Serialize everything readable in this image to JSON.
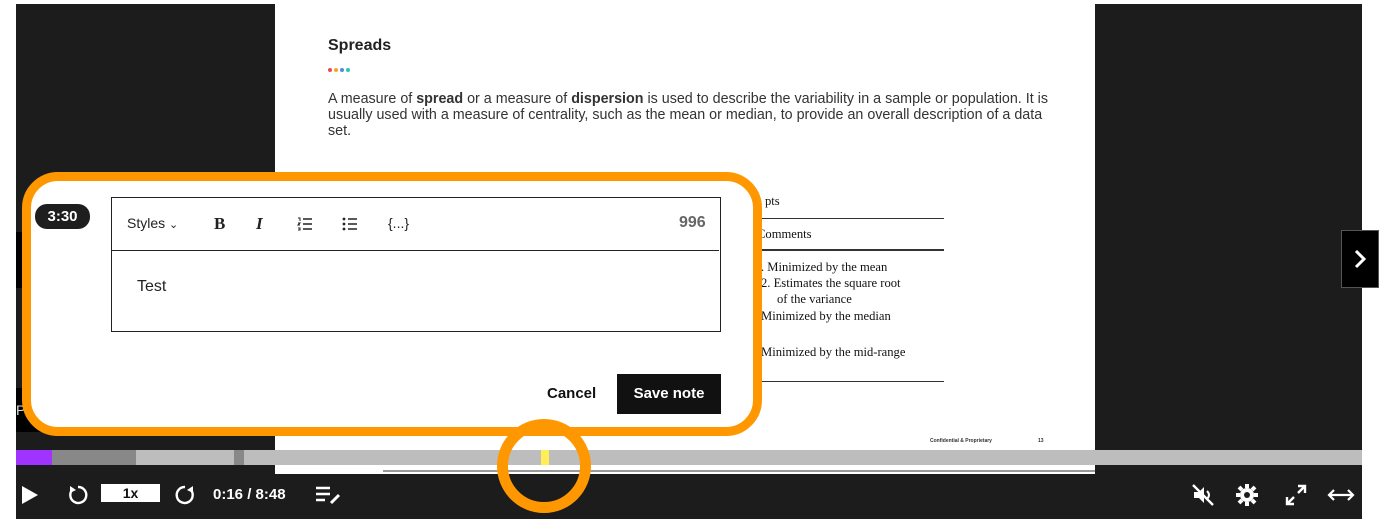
{
  "slide": {
    "title": "Spreads",
    "dot_colors": [
      "#e84a5f",
      "#f5a623",
      "#4a90d9",
      "#2fc4b2"
    ],
    "para_pre": "A measure of ",
    "para_b1": "spread",
    "para_mid": " or a measure of ",
    "para_b2": "dispersion",
    "para_post": " is used to describe the variability in a sample or population. It is usually used with a measure of centrality, such as the mean or median, to provide an overall description of a data set.",
    "table": {
      "header1": "pts",
      "header2": "Comments",
      "row1a": ". Minimized by the mean",
      "row1b": "2. Estimates the square root",
      "row1c": "of the variance",
      "row2": "Minimized by the median",
      "row3": "Minimized by the mid-range"
    },
    "footer_left": "Confidential & Proprietary",
    "footer_right": "13"
  },
  "note": {
    "timestamp": "3:30",
    "toolbar": {
      "styles_label": "Styles",
      "bold": "B",
      "italic": "I",
      "code": "{...}",
      "char_count": "996"
    },
    "content": "Test",
    "cancel_label": "Cancel",
    "save_label": "Save note"
  },
  "player": {
    "speed": "1x",
    "time": "0:16 / 8:48",
    "progress_color": "#a033ff",
    "marker_color": "#ffee55",
    "highlight_color": "#FF9800"
  }
}
